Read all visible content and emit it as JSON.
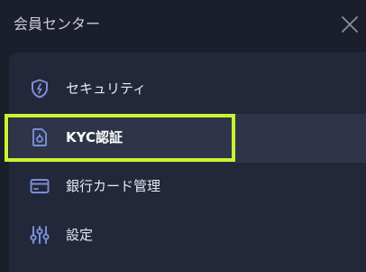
{
  "header": {
    "title": "会員センター",
    "close_icon": "close-icon"
  },
  "menu": {
    "items": [
      {
        "label": "セキュリティ",
        "icon": "shield-icon",
        "active": false
      },
      {
        "label": "KYC認証",
        "icon": "id-document-icon",
        "active": true
      },
      {
        "label": "銀行カード管理",
        "icon": "bank-card-icon",
        "active": false
      },
      {
        "label": "設定",
        "icon": "sliders-icon",
        "active": false
      }
    ]
  },
  "colors": {
    "background": "#1b1e2b",
    "card": "#23273a",
    "active_row": "#2f3449",
    "icon": "#7b8fd6",
    "text": "#e6e8ef",
    "highlight": "#c7f531"
  }
}
